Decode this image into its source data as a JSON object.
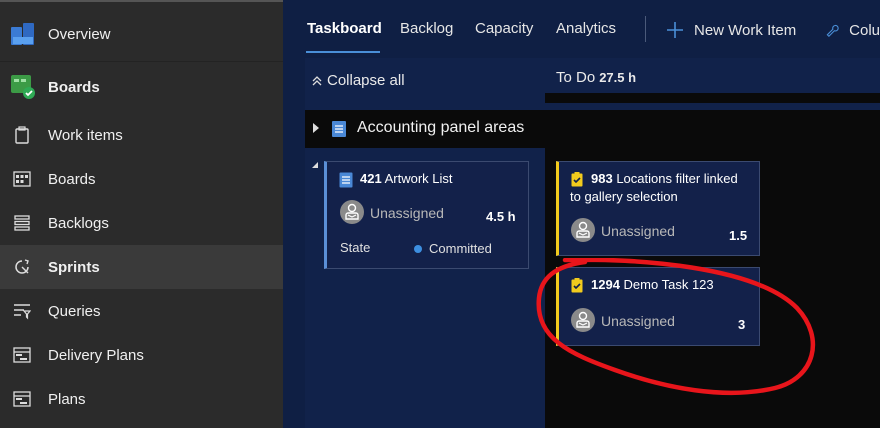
{
  "sidebar": {
    "items": [
      {
        "label": "Overview",
        "icon": "overview-icon"
      },
      {
        "label": "Boards",
        "icon": "boards-hub-icon"
      },
      {
        "label": "Work items",
        "icon": "work-items-icon"
      },
      {
        "label": "Boards",
        "icon": "boards-icon"
      },
      {
        "label": "Backlogs",
        "icon": "backlogs-icon"
      },
      {
        "label": "Sprints",
        "icon": "sprints-icon"
      },
      {
        "label": "Queries",
        "icon": "queries-icon"
      },
      {
        "label": "Delivery Plans",
        "icon": "delivery-plans-icon"
      },
      {
        "label": "Plans",
        "icon": "plans-icon"
      }
    ]
  },
  "tabs": {
    "taskboard": "Taskboard",
    "backlog": "Backlog",
    "capacity": "Capacity",
    "analytics": "Analytics",
    "new_work_item": "New Work Item",
    "column_options": "Colu"
  },
  "board": {
    "collapse_all": "Collapse all",
    "todo_label": "To Do",
    "todo_hours": "27.5 h",
    "group_label": "Accounting panel areas"
  },
  "cards": {
    "pbi": {
      "id": "421",
      "title": "Artwork List",
      "assignee": "Unassigned",
      "estimate": "4.5 h",
      "state_label": "State",
      "state_value": "Committed"
    },
    "task1": {
      "id": "983",
      "title_line1": "Locations filter linked",
      "title_line2": "to gallery selection",
      "assignee": "Unassigned",
      "remaining": "1.5"
    },
    "task2": {
      "id": "1294",
      "title": "Demo Task 123",
      "assignee": "Unassigned",
      "remaining": "3"
    }
  },
  "colors": {
    "accent": "#4a8fd8",
    "task_bar": "#f2cb1d",
    "pbi_bar": "#5b8fd6",
    "annotation": "#e8151b"
  }
}
